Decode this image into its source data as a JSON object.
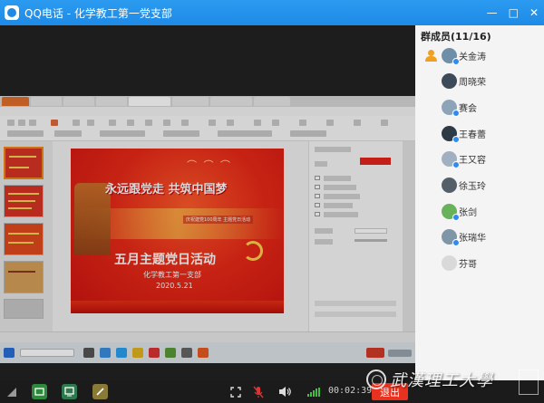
{
  "window": {
    "title": "QQ电话  -  化学教工第一党支部",
    "controls": [
      "—",
      "□",
      "✕"
    ]
  },
  "slide": {
    "headline": "永远跟党走  共筑中国梦",
    "banner": "庆祝建党100周年  主题党日活动",
    "title": "五月主题党日活动",
    "org": "化学教工第一支部",
    "date": "2020.5.21"
  },
  "members": {
    "header": "群成员(11/16)",
    "list": [
      {
        "name": "关金涛",
        "avatar_color": "#6f8fa8",
        "speaking": true,
        "host": true
      },
      {
        "name": "周晓荣",
        "avatar_color": "#3c4a5a",
        "speaking": false,
        "host": false
      },
      {
        "name": "赛会",
        "avatar_color": "#8ca3b8",
        "speaking": true,
        "host": false
      },
      {
        "name": "王春蕾",
        "avatar_color": "#2e3b46",
        "speaking": true,
        "host": false
      },
      {
        "name": "王又容",
        "avatar_color": "#9fb0c0",
        "speaking": true,
        "host": false
      },
      {
        "name": "徐玉玲",
        "avatar_color": "#555f69",
        "speaking": false,
        "host": false
      },
      {
        "name": "张剑",
        "avatar_color": "#67b35a",
        "speaking": true,
        "host": false
      },
      {
        "name": "张瑞华",
        "avatar_color": "#7f95a8",
        "speaking": true,
        "host": false
      },
      {
        "name": "芬哥",
        "avatar_color": "#d9d9d9",
        "speaking": false,
        "host": false
      }
    ]
  },
  "controls": {
    "timer": "00:02:39",
    "exit_label": "退出"
  },
  "watermark": {
    "text": "武漢理工大學"
  },
  "colors": {
    "titlebar": "#1e8ae6",
    "exit": "#e8311e",
    "slide_red": "#ea2a18"
  }
}
